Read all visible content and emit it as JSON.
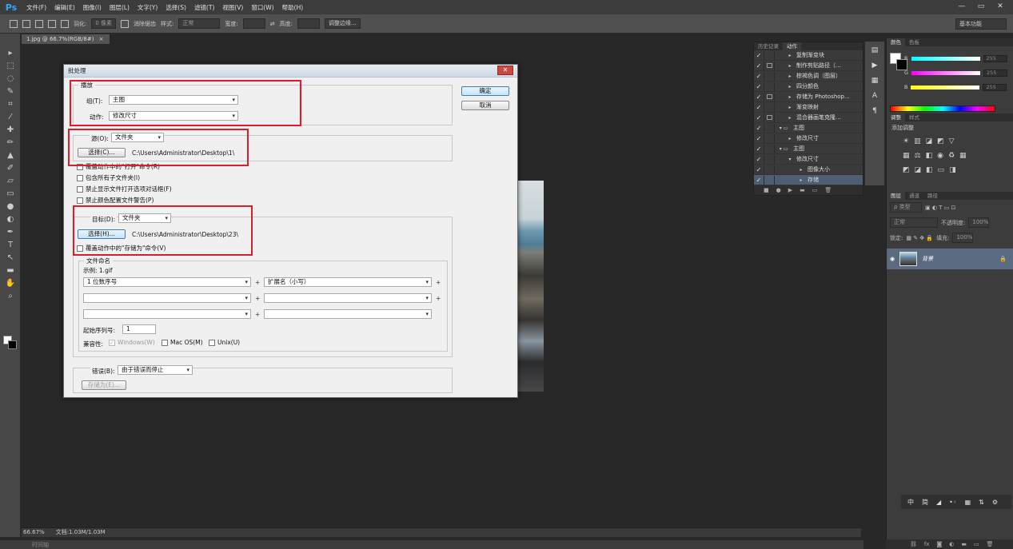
{
  "app": {
    "logo": "Ps",
    "menu": [
      "文件(F)",
      "编辑(E)",
      "图像(I)",
      "图层(L)",
      "文字(Y)",
      "选择(S)",
      "滤镜(T)",
      "视图(V)",
      "窗口(W)",
      "帮助(H)"
    ],
    "window_buttons": [
      "—",
      "▭",
      "✕"
    ]
  },
  "options_bar": {
    "feather_label": "羽化:",
    "feather_value": "0 像素",
    "antialias_label": "消除锯齿",
    "style_label": "样式:",
    "style_value": "正常",
    "width_label": "宽度:",
    "height_label": "高度:",
    "refine_edge": "调整边缘...",
    "workspace": "基本功能"
  },
  "document": {
    "tab_title": "1.jpg @ 66.7%(RGB/8#)",
    "close": "×",
    "zoom": "66.67%",
    "doc_info": "文档:1.03M/1.03M",
    "timeline_label": "时间轴"
  },
  "actions_panel": {
    "tabs": [
      "历史记录",
      "动作"
    ],
    "rows": [
      {
        "label": "复制渐变块",
        "check": "✓",
        "dialog": false,
        "expand": "▸",
        "indent": 0,
        "selected": false
      },
      {
        "label": "制作剪贴路径（...",
        "check": "✓",
        "dialog": true,
        "expand": "▸",
        "indent": 0,
        "selected": false
      },
      {
        "label": "棕褐色调（图层）",
        "check": "✓",
        "dialog": false,
        "expand": "▸",
        "indent": 0,
        "selected": false
      },
      {
        "label": "四分颜色",
        "check": "✓",
        "dialog": false,
        "expand": "▸",
        "indent": 0,
        "selected": false
      },
      {
        "label": "存储为 Photoshop...",
        "check": "✓",
        "dialog": true,
        "expand": "▸",
        "indent": 0,
        "selected": false
      },
      {
        "label": "渐变映射",
        "check": "✓",
        "dialog": false,
        "expand": "▸",
        "indent": 0,
        "selected": false
      },
      {
        "label": "混合器画笔克隆...",
        "check": "✓",
        "dialog": true,
        "expand": "▸",
        "indent": 0,
        "selected": false
      },
      {
        "label": "主图",
        "check": "✓",
        "dialog": false,
        "expand": "▾ ▭",
        "indent": -1,
        "selected": false
      },
      {
        "label": "修改尺寸",
        "check": "✓",
        "dialog": false,
        "expand": "▸",
        "indent": 0,
        "selected": false
      },
      {
        "label": "主图",
        "check": "✓",
        "dialog": false,
        "expand": "▾ ▭",
        "indent": -1,
        "selected": false
      },
      {
        "label": "修改尺寸",
        "check": "✓",
        "dialog": false,
        "expand": "▾",
        "indent": 0,
        "selected": false
      },
      {
        "label": "图像大小",
        "check": "✓",
        "dialog": false,
        "expand": "▸",
        "indent": 1,
        "selected": false
      },
      {
        "label": "存储",
        "check": "✓",
        "dialog": false,
        "expand": "▸",
        "indent": 1,
        "selected": true
      }
    ],
    "footer_icons": [
      "■",
      "●",
      "▶",
      "▬",
      "▭",
      "🗑"
    ]
  },
  "color_panel": {
    "tabs": [
      "颜色",
      "色板"
    ],
    "channels": [
      {
        "label": "R",
        "value": "255"
      },
      {
        "label": "G",
        "value": "255"
      },
      {
        "label": "B",
        "value": "255"
      }
    ]
  },
  "adjust_panel": {
    "tabs": [
      "调整",
      "样式"
    ],
    "title": "添加调整"
  },
  "layers_panel": {
    "tabs": [
      "图层",
      "通道",
      "路径"
    ],
    "kind_filter": "ρ 类型",
    "blend_mode": "正常",
    "opacity_label": "不透明度:",
    "opacity_value": "100%",
    "lock_label": "锁定:",
    "fill_label": "填充:",
    "fill_value": "100%",
    "layer_name": "背景"
  },
  "ime_bar": {
    "items": [
      "中",
      "简",
      "◢",
      "•◦",
      "▦",
      "⇅",
      "⚙"
    ]
  },
  "dialog": {
    "title": "批处理",
    "close": "✕",
    "ok": "确定",
    "cancel": "取消",
    "play": {
      "legend": "播放",
      "set_label": "组(T):",
      "set_value": "主图",
      "action_label": "动作:",
      "action_value": "修改尺寸"
    },
    "source": {
      "label": "源(O):",
      "value": "文件夹",
      "choose": "选择(C)...",
      "path": "C:\\Users\\Administrator\\Desktop\\1\\",
      "override_open": "覆盖动作中的\"打开\"命令(R)",
      "include_sub": "包含所有子文件夹(I)",
      "suppress_open": "禁止显示文件打开选项对话框(F)",
      "suppress_profile": "禁止颜色配置文件警告(P)"
    },
    "destination": {
      "label": "目标(D):",
      "value": "文件夹",
      "choose": "选择(H)...",
      "path": "C:\\Users\\Administrator\\Desktop\\23\\",
      "override_save": "覆盖动作中的\"存储为\"命令(V)"
    },
    "naming": {
      "legend": "文件命名",
      "example": "示例: 1.gif",
      "field1": "1 位数序号",
      "field2": "扩展名（小写）",
      "plus": "+",
      "start_label": "起始序列号:",
      "start_value": "1",
      "compat_label": "兼容性:",
      "windows": "Windows(W)",
      "macos": "Mac OS(M)",
      "unix": "Unix(U)"
    },
    "errors": {
      "label": "错误(B):",
      "value": "由于错误而停止",
      "save_as": "存储为(E)..."
    }
  }
}
